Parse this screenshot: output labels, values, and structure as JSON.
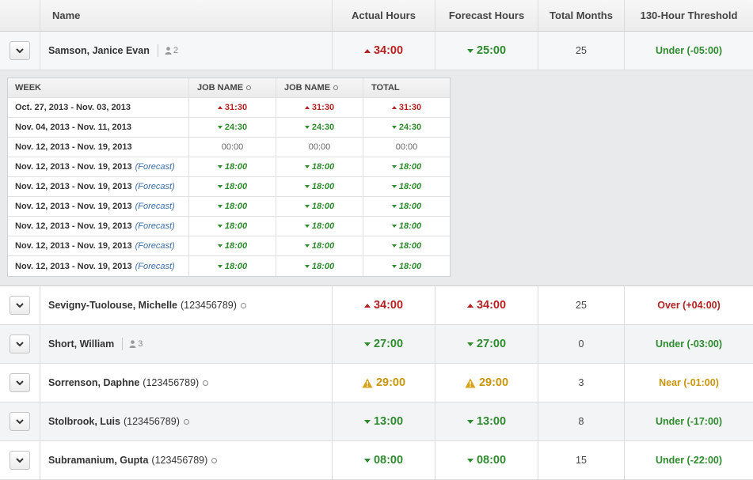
{
  "columns": {
    "name": "Name",
    "actual": "Actual Hours",
    "forecast": "Forecast Hours",
    "total_months": "Total Months",
    "threshold": "130-Hour Threshold"
  },
  "employees": [
    {
      "name": "Samson, Janice Evan",
      "id": "",
      "people_count": "2",
      "actual": "34:00",
      "actual_trend": "up",
      "forecast": "25:00",
      "forecast_trend": "down",
      "total_months": "25",
      "threshold": "Under (-05:00)",
      "threshold_status": "under",
      "expanded": true
    },
    {
      "name": "Sevigny-Tuolouse, Michelle",
      "id": "(123456789)",
      "people_count": "",
      "actual": "34:00",
      "actual_trend": "up",
      "forecast": "34:00",
      "forecast_trend": "up",
      "total_months": "25",
      "threshold": "Over (+04:00)",
      "threshold_status": "over"
    },
    {
      "name": "Short, William",
      "id": "",
      "people_count": "3",
      "actual": "27:00",
      "actual_trend": "down",
      "forecast": "27:00",
      "forecast_trend": "down",
      "total_months": "0",
      "threshold": "Under (-03:00)",
      "threshold_status": "under"
    },
    {
      "name": "Sorrenson, Daphne",
      "id": "(123456789)",
      "people_count": "",
      "actual": "29:00",
      "actual_trend": "warn",
      "forecast": "29:00",
      "forecast_trend": "warn",
      "total_months": "3",
      "threshold": "Near (-01:00)",
      "threshold_status": "near"
    },
    {
      "name": "Stolbrook, Luis",
      "id": "(123456789)",
      "people_count": "",
      "actual": "13:00",
      "actual_trend": "down",
      "forecast": "13:00",
      "forecast_trend": "down",
      "total_months": "8",
      "threshold": "Under (-17:00)",
      "threshold_status": "under"
    },
    {
      "name": "Subramanium, Gupta",
      "id": "(123456789)",
      "people_count": "",
      "actual": "08:00",
      "actual_trend": "down",
      "forecast": "08:00",
      "forecast_trend": "down",
      "total_months": "15",
      "threshold": "Under (-22:00)",
      "threshold_status": "under"
    }
  ],
  "detail": {
    "headers": {
      "week": "WEEK",
      "job1": "JOB NAME",
      "job2": "JOB NAME",
      "total": "TOTAL"
    },
    "forecast_label": "(Forecast)",
    "rows": [
      {
        "week": "Oct. 27, 2013 - Nov. 03, 2013",
        "forecast": false,
        "job1": "31:30",
        "job2": "31:30",
        "total": "31:30",
        "trend": "up"
      },
      {
        "week": "Nov. 04, 2013 - Nov. 11, 2013",
        "forecast": false,
        "job1": "24:30",
        "job2": "24:30",
        "total": "24:30",
        "trend": "down"
      },
      {
        "week": "Nov. 12, 2013 - Nov. 19, 2013",
        "forecast": false,
        "job1": "00:00",
        "job2": "00:00",
        "total": "00:00",
        "trend": "none"
      },
      {
        "week": "Nov. 12, 2013 - Nov. 19, 2013",
        "forecast": true,
        "job1": "18:00",
        "job2": "18:00",
        "total": "18:00",
        "trend": "down"
      },
      {
        "week": "Nov. 12, 2013 - Nov. 19, 2013",
        "forecast": true,
        "job1": "18:00",
        "job2": "18:00",
        "total": "18:00",
        "trend": "down"
      },
      {
        "week": "Nov. 12, 2013 - Nov. 19, 2013",
        "forecast": true,
        "job1": "18:00",
        "job2": "18:00",
        "total": "18:00",
        "trend": "down"
      },
      {
        "week": "Nov. 12, 2013 - Nov. 19, 2013",
        "forecast": true,
        "job1": "18:00",
        "job2": "18:00",
        "total": "18:00",
        "trend": "down"
      },
      {
        "week": "Nov. 12, 2013 - Nov. 19, 2013",
        "forecast": true,
        "job1": "18:00",
        "job2": "18:00",
        "total": "18:00",
        "trend": "down"
      },
      {
        "week": "Nov. 12, 2013 - Nov. 19, 2013",
        "forecast": true,
        "job1": "18:00",
        "job2": "18:00",
        "total": "18:00",
        "trend": "down"
      }
    ]
  },
  "colors": {
    "up": "#b52121",
    "down": "#2e8b2e",
    "warn": "#c9950a",
    "forecast_tag": "#3b6ea5"
  }
}
